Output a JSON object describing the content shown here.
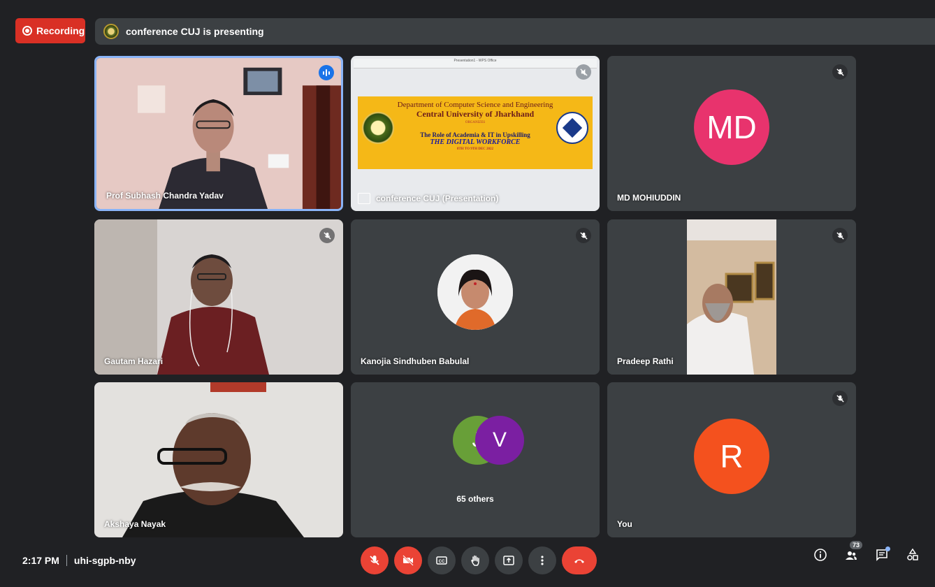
{
  "recording": {
    "label": "Recording"
  },
  "presenting": {
    "text": "conference CUJ is presenting"
  },
  "tiles": [
    {
      "name": "Prof Subhash Chandra Yadav",
      "speaking": true
    },
    {
      "name": "conference CUJ (Presentation)"
    },
    {
      "name": "MD MOHIUDDIN",
      "initials": "MD",
      "color": "#e8336d",
      "muted": true
    },
    {
      "name": "Gautam Hazari",
      "muted": true
    },
    {
      "name": "Kanojia Sindhuben Babulal",
      "muted": true
    },
    {
      "name": "Pradeep Rathi",
      "muted": true
    },
    {
      "name": "Akshaya Nayak"
    },
    {
      "name": "65 others",
      "initials_a": "J",
      "color_a": "#689f38",
      "initials_b": "V",
      "color_b": "#7b1fa2"
    },
    {
      "name": "You",
      "initials": "R",
      "color": "#f4511e",
      "muted": true
    }
  ],
  "slide": {
    "window_title": "Presentation1 - WPS Office",
    "line1": "Department of Computer Science and Engineering",
    "line2": "Central University of Jharkhand",
    "line3": "ORGANIZES",
    "line4": "The Role of Academia & IT in Upskilling",
    "line5": "THE DIGITAL WORKFORCE",
    "line6": "8TH TO 9TH DEC 2022"
  },
  "bottom": {
    "time": "2:17 PM",
    "meeting_code": "uhi-sgpb-nby",
    "participants_count": "73"
  },
  "icons": {
    "mic_off": "mic-off-icon",
    "camera_off": "camera-off-icon",
    "captions": "captions-icon",
    "raise_hand": "raise-hand-icon",
    "present": "present-icon",
    "more": "more-icon",
    "end_call": "end-call-icon",
    "info": "info-icon",
    "people": "people-icon",
    "chat": "chat-icon",
    "activities": "activities-icon"
  }
}
